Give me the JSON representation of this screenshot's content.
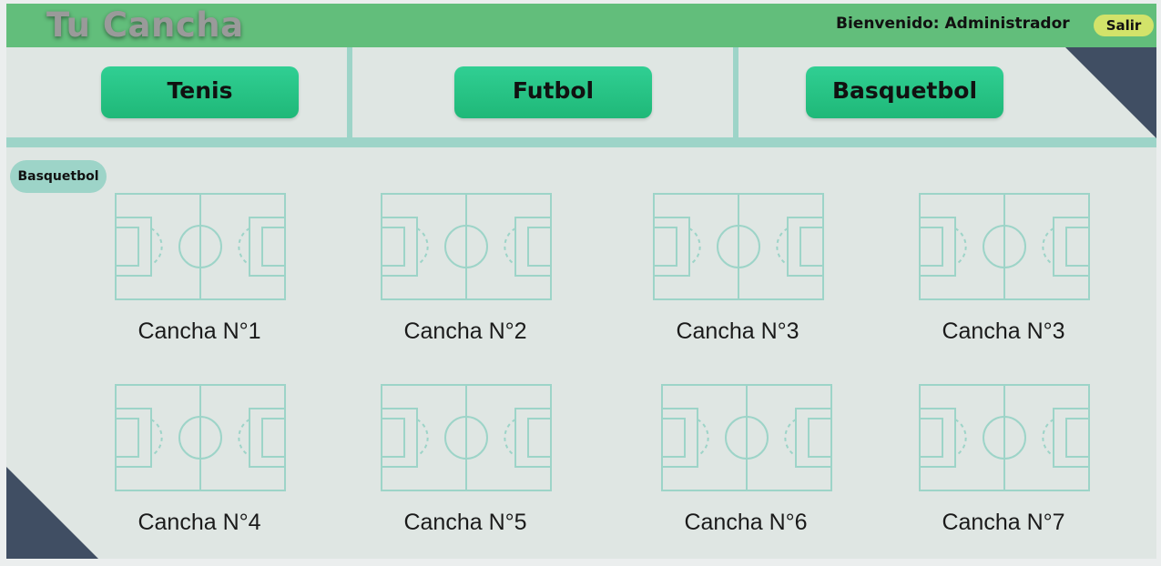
{
  "header": {
    "logo": "Tu Cancha",
    "welcome": "Bienvenido: Administrador",
    "logout_label": "Salir"
  },
  "sports": [
    "Tenis",
    "Futbol",
    "Basquetbol"
  ],
  "section_label": "Basquetbol",
  "courts": [
    {
      "label": "Cancha N°1"
    },
    {
      "label": "Cancha N°2"
    },
    {
      "label": "Cancha N°3"
    },
    {
      "label": "Cancha N°3"
    },
    {
      "label": "Cancha N°4"
    },
    {
      "label": "Cancha N°5"
    },
    {
      "label": "Cancha N°6"
    },
    {
      "label": "Cancha N°7"
    }
  ],
  "colors": {
    "header": "#62be7b",
    "sport_button": "#22c27f",
    "accent_teal": "#9dd4c8",
    "corner": "#404e63",
    "logout": "#d2e36a"
  }
}
